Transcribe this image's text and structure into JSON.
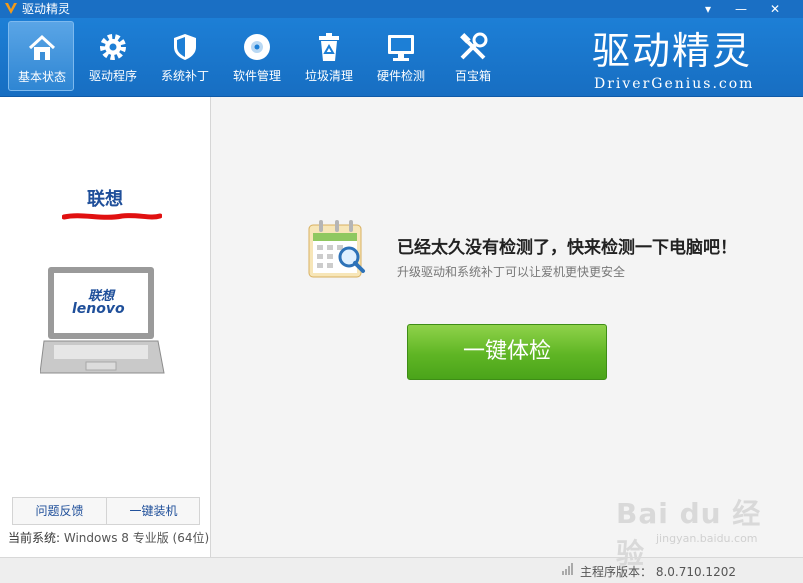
{
  "window": {
    "title": "驱动精灵"
  },
  "window_controls": {
    "menu": "▾",
    "minimize": "—",
    "close": "✕"
  },
  "toolbar": {
    "items": [
      {
        "label": "基本状态",
        "icon": "home-icon"
      },
      {
        "label": "驱动程序",
        "icon": "gear-icon"
      },
      {
        "label": "系统补丁",
        "icon": "shield-icon"
      },
      {
        "label": "软件管理",
        "icon": "disc-icon"
      },
      {
        "label": "垃圾清理",
        "icon": "recycle-bin-icon"
      },
      {
        "label": "硬件检测",
        "icon": "monitor-icon"
      },
      {
        "label": "百宝箱",
        "icon": "tools-icon"
      }
    ],
    "active_index": 0
  },
  "brand": {
    "logo_cn": "驱动精灵",
    "logo_en": "DriverGenius.com"
  },
  "device": {
    "brand_name": "联想",
    "laptop_logo_cn": "联想",
    "laptop_logo_en": "lenovo"
  },
  "left_panel": {
    "feedback_button": "问题反馈",
    "install_button": "一键装机",
    "os_label": "当前系统:",
    "os_value": "Windows 8 专业版 (64位)"
  },
  "main": {
    "headline": "已经太久没有检测了，快来检测一下电脑吧！",
    "subline": "升级驱动和系统补丁可以让爱机更快更安全",
    "scan_button": "一键体检"
  },
  "status": {
    "version_text": "主程序版本： 8.0.710.1202"
  },
  "watermark": {
    "main": "Bai du 经验",
    "sub": "jingyan.baidu.com"
  },
  "colors": {
    "title_bar": "#1a6fc4",
    "toolbar": "#1d7fd6",
    "scan_button": "#5fb524",
    "brand_text": "#1f4f9a"
  }
}
